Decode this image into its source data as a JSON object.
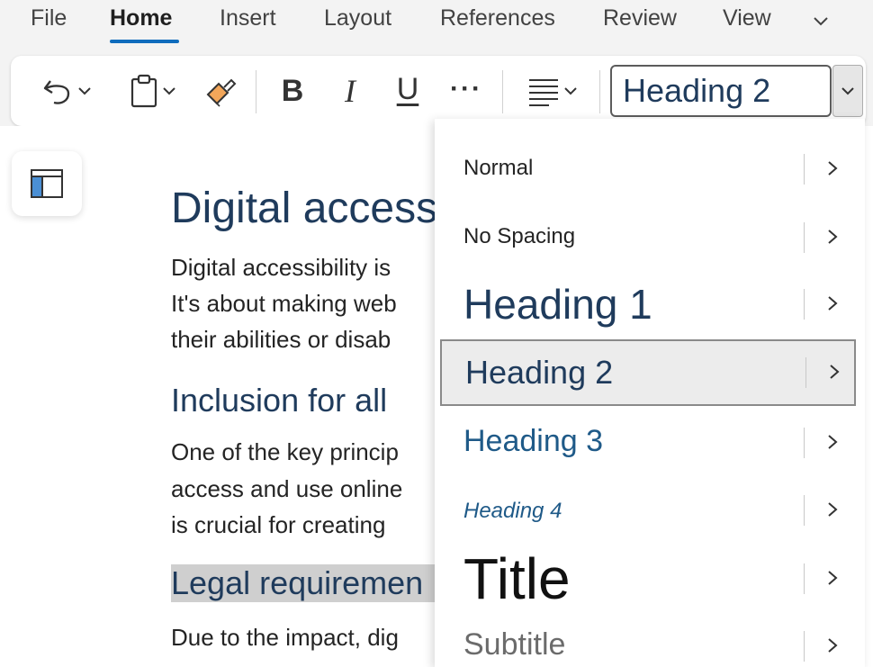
{
  "menu_tabs": [
    {
      "label": "File",
      "active": false
    },
    {
      "label": "Home",
      "active": true
    },
    {
      "label": "Insert",
      "active": false
    },
    {
      "label": "Layout",
      "active": false
    },
    {
      "label": "References",
      "active": false
    },
    {
      "label": "Review",
      "active": false
    },
    {
      "label": "View",
      "active": false
    }
  ],
  "ribbon": {
    "undo_icon": "undo-icon",
    "clipboard_icon": "clipboard-icon",
    "format_painter_icon": "format-painter-icon",
    "bold_label": "B",
    "italic_label": "I",
    "underline_label": "U",
    "more_label": "···",
    "align_icon": "align-left-icon",
    "style_value": "Heading 2"
  },
  "document": {
    "heading1": "Digital access",
    "para1": [
      "Digital accessibility is",
      "It's about making web",
      "their abilities or disab"
    ],
    "heading2a": "Inclusion for all",
    "para2": [
      "One of the key princip",
      "access and use online",
      "is crucial for creating"
    ],
    "heading2b": "Legal requiremen",
    "para3": [
      "Due to the impact, dig"
    ]
  },
  "style_gallery": {
    "items": [
      {
        "label": "Normal",
        "selected": false
      },
      {
        "label": "No Spacing",
        "selected": false
      },
      {
        "label": "Heading 1",
        "selected": false
      },
      {
        "label": "Heading 2",
        "selected": true
      },
      {
        "label": "Heading 3",
        "selected": false
      },
      {
        "label": "Heading 4",
        "selected": false
      },
      {
        "label": "Title",
        "selected": false
      },
      {
        "label": "Subtitle",
        "selected": false
      }
    ]
  },
  "colors": {
    "accent": "#0f6cbd",
    "heading": "#1f3b5c",
    "selection": "#cfcfcf"
  }
}
